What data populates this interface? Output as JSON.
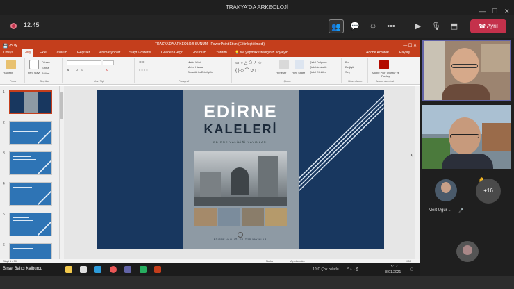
{
  "window": {
    "title": "TRAKYA'DA ARKEOLOJİ",
    "minimize": "—",
    "maximize": "☐",
    "close": "✕"
  },
  "meeting": {
    "timer": "12:45",
    "leave_label": "Ayrıl"
  },
  "ppt": {
    "title": "TRAKYA'DA ARKEOLOJİ SUNUM - PowerPoint Etkin (Etkinleştirilmedi)",
    "tabs": [
      "Dosya",
      "Giriş",
      "Ekle",
      "Tasarım",
      "Geçişler",
      "Animasyonlar",
      "Slayt Gösterisi",
      "Gözden Geçir",
      "Görünüm",
      "Yardım"
    ],
    "search_hint": "Ne yapmak istediğinizi söyleyin",
    "share_labels": [
      "Adobe Acrobat",
      "Paylaş"
    ],
    "groups": [
      "Pano",
      "Slaytlar",
      "Yazı Tipi",
      "Paragraf",
      "Çizim",
      "Düzenleme",
      "Adobe Acrobat"
    ],
    "ribbon": {
      "paste": "Yapıştır",
      "new_slide": "Yeni Slayt",
      "layout": "Düzen",
      "reset": "Sıfırla",
      "section": "Bölüm",
      "arrange": "Yerleştir",
      "quick_styles": "Hızlı Stiller",
      "find": "Bul",
      "replace": "Değiştir",
      "select": "Seç",
      "create_pdf": "Adobe PDF Oluştur ve Paylaş",
      "text_dir": "Metin Yönü",
      "align_text": "Metni Hizala",
      "smartart": "SmartArt'a Dönüştür",
      "shape_fill": "Şekil Dolgusu",
      "shape_outline": "Şekil Anahattı",
      "shape_effects": "Şekil Efektleri"
    },
    "slide_numbers": [
      "1",
      "2",
      "3",
      "4",
      "5",
      "6"
    ],
    "status_left": "Slayt 1 / 50",
    "status_notes": "Notlar",
    "status_comments": "Açıklamalar",
    "status_zoom": "%50"
  },
  "slide": {
    "title1": "EDİRNE",
    "title2": "KALELERİ",
    "subtitle": "EDİRNE VALİLİĞİ YAYINLARI",
    "footer": "EDİRNE VALİLİĞİ KÜLTÜR YAYINLARI"
  },
  "participants": {
    "name": "Mert Uğur ...",
    "more_count": "+16"
  },
  "taskbar": {
    "user": "Birsel Balıcı Kalburcu",
    "weather": "10°C Çok bulutlu",
    "time": "15:12",
    "date": "8.01.2021"
  },
  "colors": {
    "ppt_accent": "#c43e1c",
    "teams_leave": "#c4314b",
    "slide_blue": "#18375f",
    "active_border": "#6264a7"
  }
}
